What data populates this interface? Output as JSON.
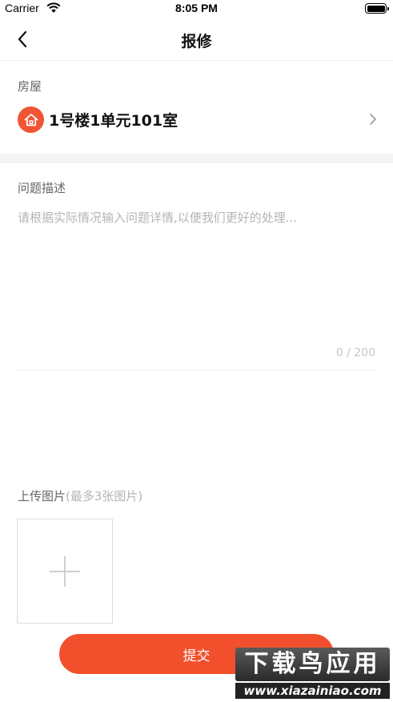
{
  "status_bar": {
    "carrier": "Carrier",
    "time": "8:05 PM"
  },
  "nav": {
    "title": "报修"
  },
  "house": {
    "label": "房屋",
    "name": "1号楼1单元101室"
  },
  "problem": {
    "label": "问题描述",
    "placeholder": "请根据实际情况输入问题详情,以便我们更好的处理...",
    "value": "",
    "char_count": "0 / 200"
  },
  "upload": {
    "label": "上传图片",
    "hint": "(最多3张图片)"
  },
  "submit": {
    "label": "提交"
  },
  "watermark": {
    "title": "下载鸟应用",
    "url": "www.xiazainiao.com"
  },
  "colors": {
    "accent": "#f2502d",
    "icon_bg": "#f25533",
    "section_gap": "#f3f4f6"
  },
  "icons": [
    "wifi-icon",
    "battery-icon",
    "back-arrow-icon",
    "house-icon",
    "chevron-right-icon",
    "plus-icon"
  ]
}
